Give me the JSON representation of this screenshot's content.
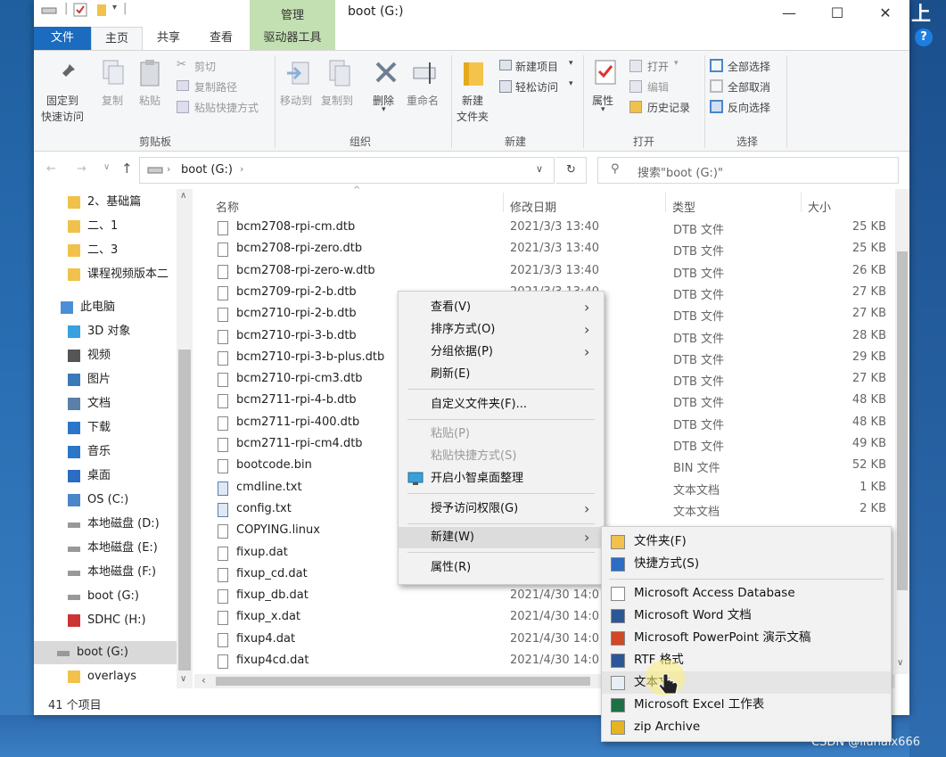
{
  "window": {
    "title": "boot (G:)",
    "manage_tab": "管理",
    "minimize": "—",
    "maximize": "☐",
    "close": "✕"
  },
  "ribbon": {
    "tabs": [
      "文件",
      "主页",
      "共享",
      "查看",
      "驱动器工具"
    ],
    "clipboard": {
      "pin": "固定到\n快速访问",
      "pin_l1": "固定到",
      "pin_l2": "快速访问",
      "copy": "复制",
      "paste": "粘贴",
      "cut": "剪切",
      "copy_path": "复制路径",
      "paste_shortcut": "粘贴快捷方式",
      "group": "剪贴板"
    },
    "organize": {
      "move_to": "移动到",
      "copy_to": "复制到",
      "delete": "删除",
      "rename": "重命名",
      "group": "组织"
    },
    "new": {
      "new_folder_l1": "新建",
      "new_folder_l2": "文件夹",
      "new_item": "新建项目",
      "easy_access": "轻松访问",
      "group": "新建"
    },
    "open": {
      "properties": "属性",
      "open": "打开",
      "edit": "编辑",
      "history": "历史记录",
      "group": "打开"
    },
    "select": {
      "select_all": "全部选择",
      "select_none": "全部取消",
      "invert": "反向选择",
      "group": "选择"
    }
  },
  "address": {
    "path": "boot (G:)",
    "search_placeholder": "搜索\"boot (G:)\""
  },
  "nav": [
    {
      "label": "2、基础篇",
      "icon": "folder"
    },
    {
      "label": "二、1",
      "icon": "folder"
    },
    {
      "label": "二、3",
      "icon": "folder"
    },
    {
      "label": "课程视频版本二",
      "icon": "folder"
    },
    {
      "label": "此电脑",
      "icon": "pc"
    },
    {
      "label": "3D 对象",
      "icon": "cube"
    },
    {
      "label": "视频",
      "icon": "video"
    },
    {
      "label": "图片",
      "icon": "image"
    },
    {
      "label": "文档",
      "icon": "doc"
    },
    {
      "label": "下载",
      "icon": "download"
    },
    {
      "label": "音乐",
      "icon": "music"
    },
    {
      "label": "桌面",
      "icon": "desktop"
    },
    {
      "label": "OS (C:)",
      "icon": "drive-os"
    },
    {
      "label": "本地磁盘 (D:)",
      "icon": "drive"
    },
    {
      "label": "本地磁盘 (E:)",
      "icon": "drive"
    },
    {
      "label": "本地磁盘 (F:)",
      "icon": "drive"
    },
    {
      "label": "boot (G:)",
      "icon": "drive"
    },
    {
      "label": "SDHC (H:)",
      "icon": "sd"
    },
    {
      "label": "boot (G:)",
      "icon": "drive"
    },
    {
      "label": "overlays",
      "icon": "folder"
    }
  ],
  "columns": {
    "name": "名称",
    "date": "修改日期",
    "type": "类型",
    "size": "大小"
  },
  "files": [
    {
      "name": "bcm2708-rpi-cm.dtb",
      "date": "2021/3/3 13:40",
      "type": "DTB 文件",
      "size": "25 KB"
    },
    {
      "name": "bcm2708-rpi-zero.dtb",
      "date": "2021/3/3 13:40",
      "type": "DTB 文件",
      "size": "25 KB"
    },
    {
      "name": "bcm2708-rpi-zero-w.dtb",
      "date": "2021/3/3 13:40",
      "type": "DTB 文件",
      "size": "26 KB"
    },
    {
      "name": "bcm2709-rpi-2-b.dtb",
      "date": "2021/3/3 13:40",
      "type": "DTB 文件",
      "size": "27 KB"
    },
    {
      "name": "bcm2710-rpi-2-b.dtb",
      "date": "",
      "type": "DTB 文件",
      "size": "27 KB"
    },
    {
      "name": "bcm2710-rpi-3-b.dtb",
      "date": "",
      "type": "DTB 文件",
      "size": "28 KB"
    },
    {
      "name": "bcm2710-rpi-3-b-plus.dtb",
      "date": "",
      "type": "DTB 文件",
      "size": "29 KB"
    },
    {
      "name": "bcm2710-rpi-cm3.dtb",
      "date": "",
      "type": "DTB 文件",
      "size": "27 KB"
    },
    {
      "name": "bcm2711-rpi-4-b.dtb",
      "date": "",
      "type": "DTB 文件",
      "size": "48 KB"
    },
    {
      "name": "bcm2711-rpi-400.dtb",
      "date": "",
      "type": "DTB 文件",
      "size": "48 KB"
    },
    {
      "name": "bcm2711-rpi-cm4.dtb",
      "date": "",
      "type": "DTB 文件",
      "size": "49 KB"
    },
    {
      "name": "bootcode.bin",
      "date": "",
      "type": "BIN 文件",
      "size": "52 KB"
    },
    {
      "name": "cmdline.txt",
      "date": "",
      "type": "文本文档",
      "size": "1 KB"
    },
    {
      "name": "config.txt",
      "date": "",
      "type": "文本文档",
      "size": "2 KB"
    },
    {
      "name": "COPYING.linux",
      "date": "",
      "type": "",
      "size": ""
    },
    {
      "name": "fixup.dat",
      "date": "",
      "type": "",
      "size": ""
    },
    {
      "name": "fixup_cd.dat",
      "date": "",
      "type": "",
      "size": ""
    },
    {
      "name": "fixup_db.dat",
      "date": "2021/4/30 14:0",
      "type": "",
      "size": ""
    },
    {
      "name": "fixup_x.dat",
      "date": "2021/4/30 14:0",
      "type": "",
      "size": ""
    },
    {
      "name": "fixup4.dat",
      "date": "2021/4/30 14:0",
      "type": "",
      "size": ""
    },
    {
      "name": "fixup4cd.dat",
      "date": "2021/4/30 14:0",
      "type": "",
      "size": ""
    }
  ],
  "status": {
    "count": "41 个项目"
  },
  "context_menu": {
    "view": "查看(V)",
    "sort": "排序方式(O)",
    "group": "分组依据(P)",
    "refresh": "刷新(E)",
    "customize": "自定义文件夹(F)...",
    "paste": "粘贴(P)",
    "paste_shortcut": "粘贴快捷方式(S)",
    "desktop_organizer": "开启小智桌面整理",
    "grant_access": "授予访问权限(G)",
    "new": "新建(W)",
    "properties": "属性(R)"
  },
  "submenu": [
    {
      "label": "文件夹(F)",
      "icon": "folder"
    },
    {
      "label": "快捷方式(S)",
      "icon": "shortcut"
    },
    {
      "label": "Microsoft Access Database",
      "icon": "blank"
    },
    {
      "label": "Microsoft Word 文档",
      "icon": "word"
    },
    {
      "label": "Microsoft PowerPoint 演示文稿",
      "icon": "powerpoint"
    },
    {
      "label": "RTF 格式",
      "icon": "rtf"
    },
    {
      "label": "文本文",
      "icon": "text"
    },
    {
      "label": "Microsoft Excel 工作表",
      "icon": "excel"
    },
    {
      "label": "zip Archive",
      "icon": "zip"
    }
  ],
  "watermark": "CSDN @liuhaix666"
}
